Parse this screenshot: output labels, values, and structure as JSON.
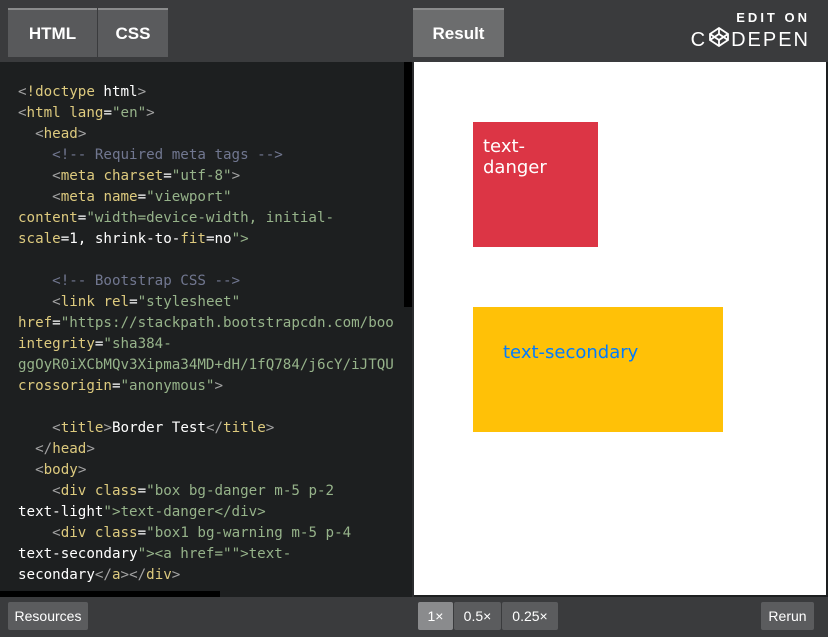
{
  "tabs": {
    "html": "HTML",
    "css": "CSS",
    "result": "Result"
  },
  "brand": {
    "edit_on": "EDIT ON",
    "name_left": "C",
    "name_right": "DEPEN"
  },
  "code_lines": [
    "<!doctype html>",
    "<html lang=\"en\">",
    "  <head>",
    "    <!-- Required meta tags -->",
    "    <meta charset=\"utf-8\">",
    "    <meta name=\"viewport\"",
    "content=\"width=device-width, initial-",
    "scale=1, shrink-to-fit=no\">",
    "",
    "    <!-- Bootstrap CSS -->",
    "    <link rel=\"stylesheet\"",
    "href=\"https://stackpath.bootstrapcdn.com/boo",
    "integrity=\"sha384-",
    "ggOyR0iXCbMQv3Xipma34MD+dH/1fQ784/j6cY/iJTQU",
    "crossorigin=\"anonymous\">",
    "",
    "    <title>Border Test</title>",
    "  </head>",
    "  <body>",
    "    <div class=\"box bg-danger m-5 p-2",
    "text-light\">text-danger</div>",
    "    <div class=\"box1 bg-warning m-5 p-4",
    "text-secondary\"><a href=\"\">text-",
    "secondary</a></div>"
  ],
  "result": {
    "danger_text": "text-danger",
    "warning_link": "text-secondary"
  },
  "bottom": {
    "resources": "Resources",
    "zoom_1x": "1×",
    "zoom_05x": "0.5×",
    "zoom_025x": "0.25×",
    "rerun": "Rerun"
  },
  "colors": {
    "danger": "#dc3545",
    "warning": "#ffc107",
    "link": "#007bff"
  }
}
